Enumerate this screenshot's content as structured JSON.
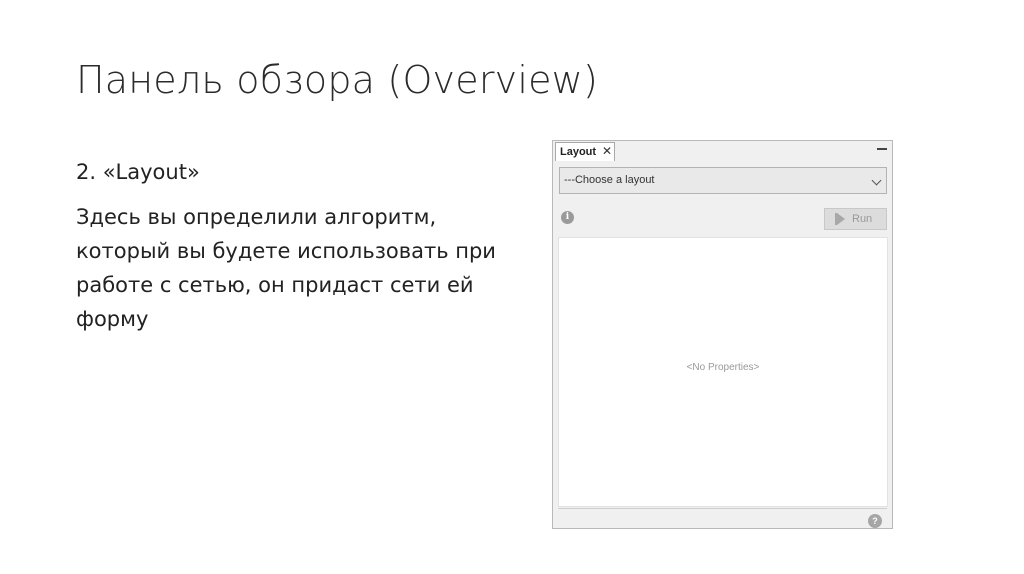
{
  "slide": {
    "title": "Панель обзора (Overview)",
    "subtitle": "2. «Layout»",
    "body": "Здесь вы определили алгоритм, который вы будете использовать при работе с сетью, он придаст сети ей форму"
  },
  "panel": {
    "tab_label": "Layout",
    "tab_close_glyph": "✕",
    "select_value": "---Choose a layout",
    "info_glyph": "i",
    "run_label": "Run",
    "empty_text": "<No Properties>",
    "help_glyph": "?",
    "icons": [
      "close-icon",
      "minimize-icon",
      "chevron-down-icon",
      "info-icon",
      "play-icon",
      "help-icon"
    ]
  }
}
